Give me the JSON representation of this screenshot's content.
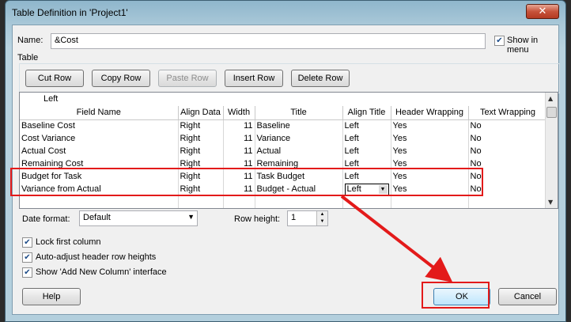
{
  "window": {
    "title": "Table Definition in 'Project1'",
    "close_glyph": "✕"
  },
  "name_field": {
    "label": "Name:",
    "value": "&Cost",
    "show_in_menu_label": "Show in menu",
    "show_in_menu_checked": true
  },
  "table_group": {
    "label": "Table",
    "buttons": {
      "cut_row": "Cut Row",
      "copy_row": "Copy Row",
      "paste_row": "Paste Row",
      "insert_row": "Insert Row",
      "delete_row": "Delete Row"
    }
  },
  "grid": {
    "edit_value": "Left",
    "columns": [
      "Field Name",
      "Align Data",
      "Width",
      "Title",
      "Align Title",
      "Header Wrapping",
      "Text Wrapping"
    ],
    "rows": [
      [
        "Baseline Cost",
        "Right",
        "11",
        "Baseline",
        "Left",
        "Yes",
        "No"
      ],
      [
        "Cost Variance",
        "Right",
        "11",
        "Variance",
        "Left",
        "Yes",
        "No"
      ],
      [
        "Actual Cost",
        "Right",
        "11",
        "Actual",
        "Left",
        "Yes",
        "No"
      ],
      [
        "Remaining Cost",
        "Right",
        "11",
        "Remaining",
        "Left",
        "Yes",
        "No"
      ],
      [
        "Budget for Task",
        "Right",
        "11",
        "Task Budget",
        "Left",
        "Yes",
        "No"
      ],
      [
        "Variance from Actual",
        "Right",
        "11",
        "Budget - Actual",
        "Left",
        "Yes",
        "No"
      ]
    ]
  },
  "options": {
    "date_format_label": "Date format:",
    "date_format_value": "Default",
    "row_height_label": "Row height:",
    "row_height_value": "1",
    "lock_first_column": "Lock first column",
    "auto_adjust": "Auto-adjust header row heights",
    "show_add_new_column": "Show 'Add New Column' interface"
  },
  "footer": {
    "help": "Help",
    "ok": "OK",
    "cancel": "Cancel"
  },
  "colors": {
    "annotation_red": "#e31a1a"
  }
}
